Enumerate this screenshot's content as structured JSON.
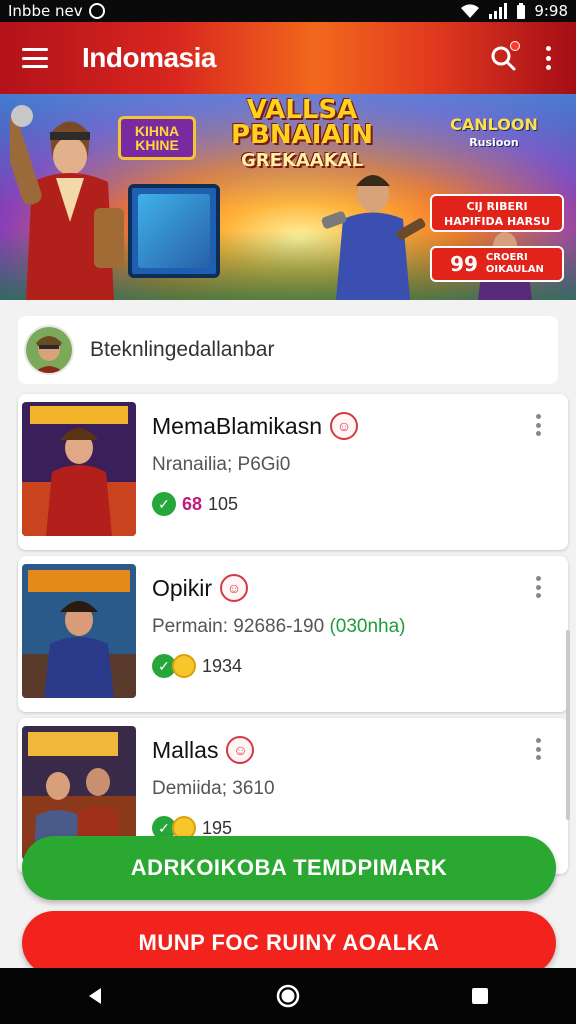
{
  "status_bar": {
    "carrier": "Inbbe nev",
    "time": "9:98"
  },
  "app_bar": {
    "title": "Indomasia"
  },
  "banner": {
    "badge_left": [
      "KIHNA",
      "KHINE"
    ],
    "title_lines": [
      "VALLSA",
      "PBNAIAIN",
      "GREKAAKAL"
    ],
    "brand": "CANLOON",
    "brand_sub": "Rusioon",
    "promo_1": [
      "CIJ RIBERI",
      "HAPIFIDA HARSU"
    ],
    "promo_2_number": "99",
    "promo_2_text": [
      "CROERI",
      "OIKAULAN"
    ]
  },
  "user": {
    "name": "Bteknlingedallanbar"
  },
  "games": [
    {
      "title": "MemaBlamikasn",
      "subtitle": "Nranailia; P6Gi0",
      "count_colored": "68",
      "count": "105"
    },
    {
      "title": "Opikir",
      "subtitle": "Permain: 92686-190",
      "subtitle_hl": "(030nha)",
      "count": "1934"
    },
    {
      "title": "Mallas",
      "subtitle": "Demiida; 3610",
      "count": "195"
    }
  ],
  "buttons": {
    "primary": "ADRKOIKOBA TEMDPIMARK",
    "secondary": "MUNP FOC RUINY AOALKA"
  },
  "colors": {
    "accent_red": "#e2231a",
    "accent_green": "#2aa831"
  }
}
